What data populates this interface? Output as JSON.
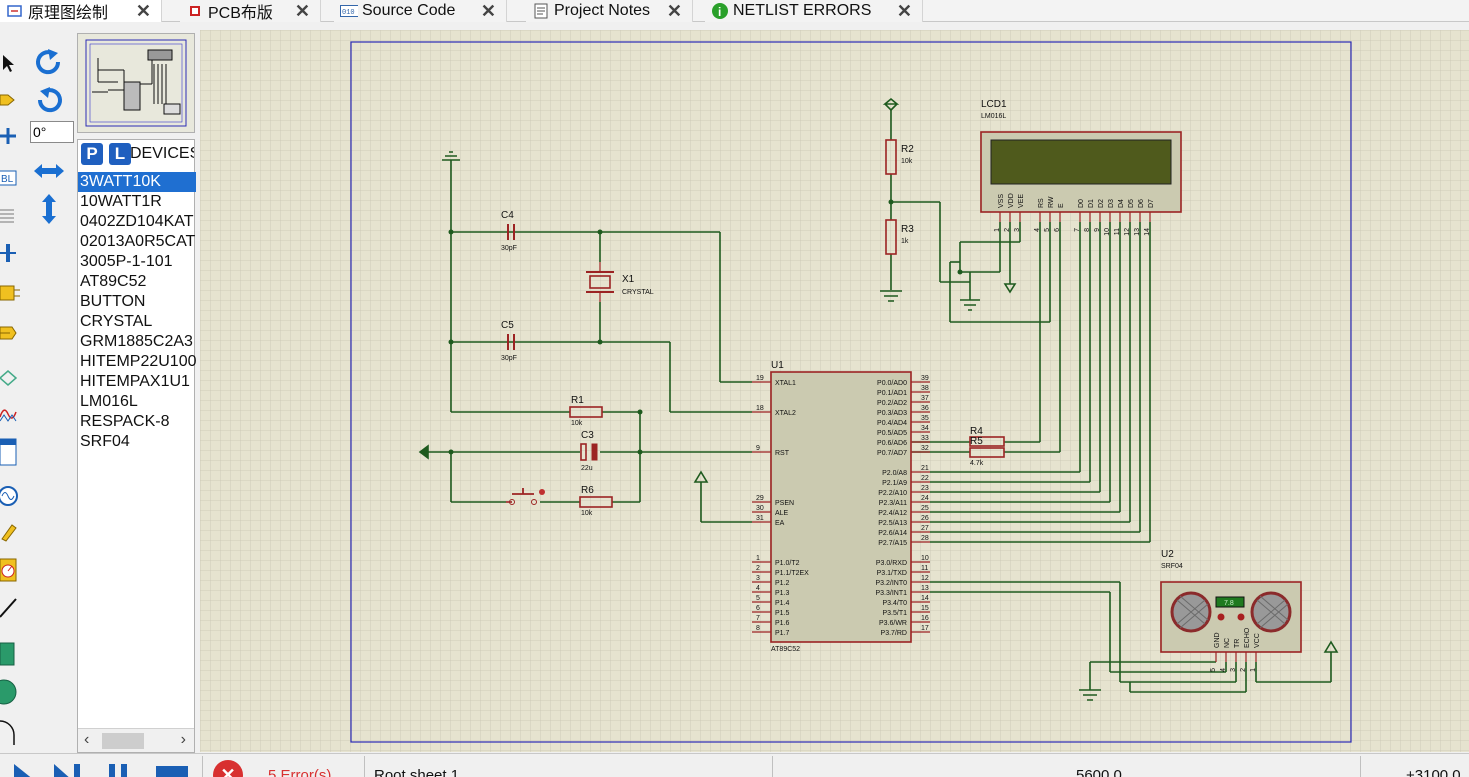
{
  "tabs": [
    {
      "label": "原理图绘制",
      "icon": "schematic-icon",
      "active": true
    },
    {
      "label": "PCB布版",
      "icon": "pcb-chip-icon",
      "active": false
    },
    {
      "label": "Source Code",
      "icon": "source-code-icon",
      "active": false
    },
    {
      "label": "Project Notes",
      "icon": "notes-icon",
      "active": false
    },
    {
      "label": "NETLIST ERRORS",
      "icon": "info-icon",
      "active": false
    }
  ],
  "rotation": {
    "angle": "0°"
  },
  "device_panel": {
    "p_label": "P",
    "l_label": "L",
    "header": "DEVICES",
    "items": [
      "3WATT10K",
      "10WATT1R",
      "0402ZD104KAT",
      "02013A0R5CAT",
      "3005P-1-101",
      "AT89C52",
      "BUTTON",
      "CRYSTAL",
      "GRM1885C2A3",
      "HITEMP22U100",
      "HITEMPAX1U1",
      "LM016L",
      "RESPACK-8",
      "SRF04"
    ],
    "selected_index": 0
  },
  "schematic": {
    "u1": {
      "ref": "U1",
      "part": "AT89C52",
      "left_pins": [
        {
          "num": "19",
          "name": "XTAL1"
        },
        {
          "num": "18",
          "name": "XTAL2"
        },
        {
          "num": "9",
          "name": "RST"
        },
        {
          "num": "29",
          "name": "PSEN"
        },
        {
          "num": "30",
          "name": "ALE"
        },
        {
          "num": "31",
          "name": "EA"
        },
        {
          "num": "1",
          "name": "P1.0/T2"
        },
        {
          "num": "2",
          "name": "P1.1/T2EX"
        },
        {
          "num": "3",
          "name": "P1.2"
        },
        {
          "num": "4",
          "name": "P1.3"
        },
        {
          "num": "5",
          "name": "P1.4"
        },
        {
          "num": "6",
          "name": "P1.5"
        },
        {
          "num": "7",
          "name": "P1.6"
        },
        {
          "num": "8",
          "name": "P1.7"
        }
      ],
      "right_pins": [
        {
          "num": "39",
          "name": "P0.0/AD0"
        },
        {
          "num": "38",
          "name": "P0.1/AD1"
        },
        {
          "num": "37",
          "name": "P0.2/AD2"
        },
        {
          "num": "36",
          "name": "P0.3/AD3"
        },
        {
          "num": "35",
          "name": "P0.4/AD4"
        },
        {
          "num": "34",
          "name": "P0.5/AD5"
        },
        {
          "num": "33",
          "name": "P0.6/AD6"
        },
        {
          "num": "32",
          "name": "P0.7/AD7"
        },
        {
          "num": "21",
          "name": "P2.0/A8"
        },
        {
          "num": "22",
          "name": "P2.1/A9"
        },
        {
          "num": "23",
          "name": "P2.2/A10"
        },
        {
          "num": "24",
          "name": "P2.3/A11"
        },
        {
          "num": "25",
          "name": "P2.4/A12"
        },
        {
          "num": "26",
          "name": "P2.5/A13"
        },
        {
          "num": "27",
          "name": "P2.6/A14"
        },
        {
          "num": "28",
          "name": "P2.7/A15"
        },
        {
          "num": "10",
          "name": "P3.0/RXD"
        },
        {
          "num": "11",
          "name": "P3.1/TXD"
        },
        {
          "num": "12",
          "name": "P3.2/INT0"
        },
        {
          "num": "13",
          "name": "P3.3/INT1"
        },
        {
          "num": "14",
          "name": "P3.4/T0"
        },
        {
          "num": "15",
          "name": "P3.5/T1"
        },
        {
          "num": "16",
          "name": "P3.6/WR"
        },
        {
          "num": "17",
          "name": "P3.7/RD"
        }
      ]
    },
    "lcd": {
      "ref": "LCD1",
      "part": "LM016L",
      "pins": [
        {
          "name": "VSS",
          "num": "1"
        },
        {
          "name": "VDD",
          "num": "2"
        },
        {
          "name": "VEE",
          "num": "3"
        },
        {
          "name": "RS",
          "num": "4"
        },
        {
          "name": "RW",
          "num": "5"
        },
        {
          "name": "E",
          "num": "6"
        },
        {
          "name": "D0",
          "num": "7"
        },
        {
          "name": "D1",
          "num": "8"
        },
        {
          "name": "D2",
          "num": "9"
        },
        {
          "name": "D3",
          "num": "10"
        },
        {
          "name": "D4",
          "num": "11"
        },
        {
          "name": "D5",
          "num": "12"
        },
        {
          "name": "D6",
          "num": "13"
        },
        {
          "name": "D7",
          "num": "14"
        }
      ]
    },
    "u2": {
      "ref": "U2",
      "part": "SRF04",
      "display": "7.8",
      "pins": [
        {
          "name": "GND",
          "num": "5"
        },
        {
          "name": "NC",
          "num": "4"
        },
        {
          "name": "TR",
          "num": "3"
        },
        {
          "name": "ECHO",
          "num": "2"
        },
        {
          "name": "VCC",
          "num": "1"
        }
      ]
    },
    "r2": {
      "ref": "R2",
      "value": "10k"
    },
    "r3": {
      "ref": "R3",
      "value": "1k"
    },
    "c4": {
      "ref": "C4",
      "value": "30pF"
    },
    "c5": {
      "ref": "C5",
      "value": "30pF"
    },
    "x1": {
      "ref": "X1",
      "value": "CRYSTAL"
    },
    "r1": {
      "ref": "R1",
      "value": "10k"
    },
    "c3": {
      "ref": "C3",
      "value": "22u"
    },
    "r6": {
      "ref": "R6",
      "value": "10k"
    },
    "r4": {
      "ref": "R4",
      "value": ""
    },
    "r5": {
      "ref": "R5",
      "value": "4.7k"
    }
  },
  "status": {
    "errors": "5 Error(s)",
    "sheet": "Root sheet 1",
    "coord_x": "5600.0",
    "coord_y": "+3100.0"
  },
  "colors": {
    "canvas_bg": "#e6e3cf",
    "grid": "#c9c6b4",
    "wire": "#1e5a1e",
    "component": "#9c2323",
    "chip_fill": "#cbcab0",
    "sheet_border": "#2b2bb5"
  }
}
